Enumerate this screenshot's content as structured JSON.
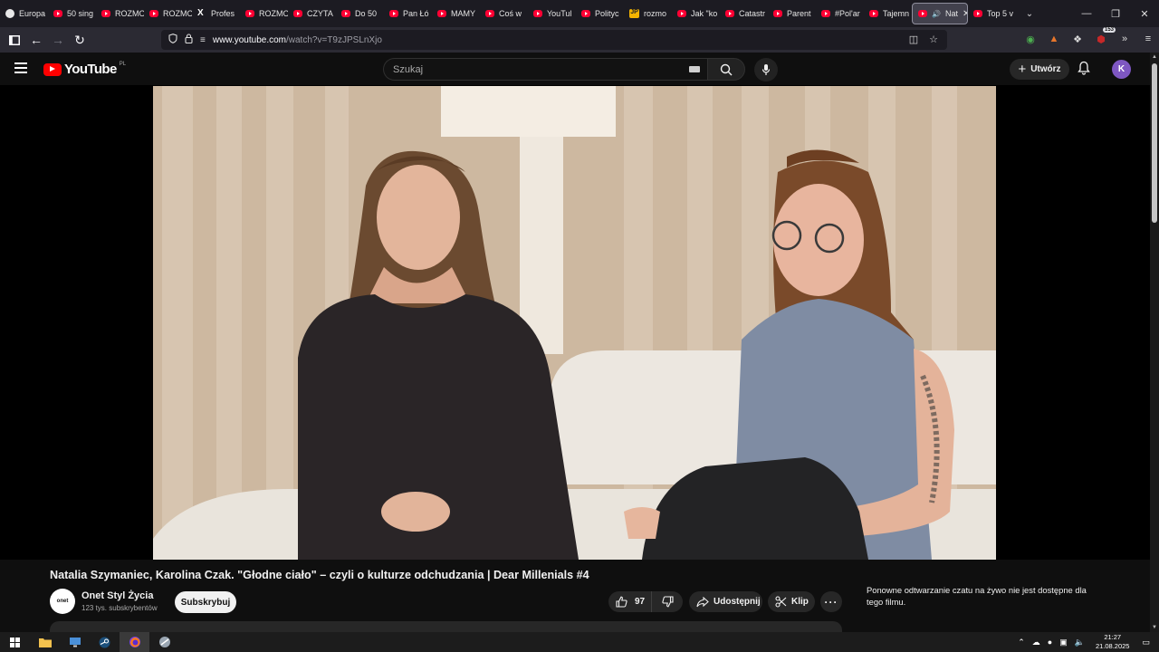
{
  "browser": {
    "tabs": [
      {
        "label": "Europa",
        "icon": "globe-icon"
      },
      {
        "label": "50 sing",
        "icon": "youtube-icon"
      },
      {
        "label": "ROZMO",
        "icon": "youtube-icon"
      },
      {
        "label": "ROZMO",
        "icon": "youtube-icon"
      },
      {
        "label": "Profes",
        "icon": "x-icon"
      },
      {
        "label": "ROZMO",
        "icon": "youtube-icon"
      },
      {
        "label": "CZYTA",
        "icon": "youtube-icon"
      },
      {
        "label": "Do 50",
        "icon": "youtube-icon"
      },
      {
        "label": "Pan Łó",
        "icon": "youtube-icon"
      },
      {
        "label": "MAMY",
        "icon": "youtube-icon"
      },
      {
        "label": "Coś w",
        "icon": "youtube-icon"
      },
      {
        "label": "YouTul",
        "icon": "youtube-icon"
      },
      {
        "label": "Polityc",
        "icon": "youtube-icon"
      },
      {
        "label": "rozmo",
        "icon": "jp-icon"
      },
      {
        "label": "Jak \"ko",
        "icon": "youtube-icon"
      },
      {
        "label": "Catastr",
        "icon": "youtube-icon"
      },
      {
        "label": "Parent",
        "icon": "youtube-icon"
      },
      {
        "label": "#Pol'ar",
        "icon": "youtube-icon"
      },
      {
        "label": "Tajemn",
        "icon": "youtube-icon"
      },
      {
        "label": "Nat",
        "icon": "youtube-icon",
        "active": true
      },
      {
        "label": "Top 5 v",
        "icon": "youtube-icon"
      }
    ],
    "url_host": "www.youtube.com",
    "url_path": "/watch?v=T9zJPSLnXjo",
    "extension_badge": "153"
  },
  "youtube": {
    "logo_text": "YouTube",
    "country_code": "PL",
    "search_placeholder": "Szukaj",
    "create_label": "Utwórz",
    "avatar_letter": "K"
  },
  "video": {
    "title": "Natalia Szymaniec, Karolina Czak. \"Głodne ciało\" – czyli o kulturze odchudzania | Dear Millenials #4",
    "channel_name": "Onet Styl Życia",
    "channel_logo_text": "onet",
    "subscribers": "123 tys. subskrybentów",
    "subscribe_label": "Subskrybuj",
    "likes": "97",
    "share_label": "Udostępnij",
    "clip_label": "Klip",
    "more_label": "···",
    "chat_note": "Ponowne odtwarzanie czatu na żywo nie jest dostępne dla tego filmu."
  },
  "taskbar": {
    "time": "21:27",
    "date": "21.08.2025"
  },
  "colors": {
    "youtube_red": "#ff0000",
    "page_bg": "#0f0f0f",
    "avatar": "#7e57c2"
  }
}
